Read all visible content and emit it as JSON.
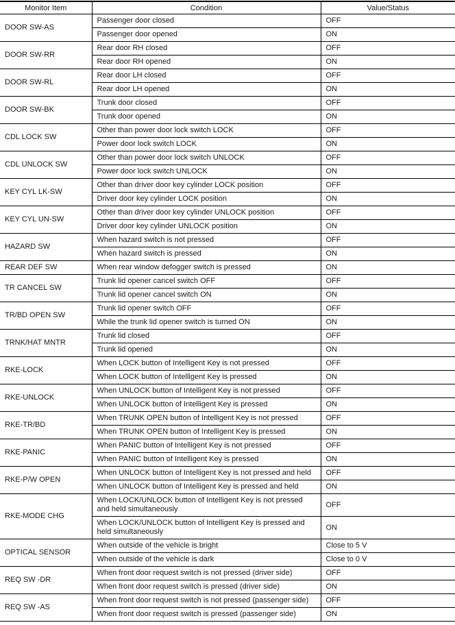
{
  "table": {
    "headers": [
      "Monitor Item",
      "Condition",
      "Value/Status"
    ],
    "items": [
      {
        "name": "DOOR SW-AS",
        "rows": [
          {
            "condition": "Passenger door closed",
            "value": "OFF"
          },
          {
            "condition": "Passenger door opened",
            "value": "ON"
          }
        ]
      },
      {
        "name": "DOOR SW-RR",
        "rows": [
          {
            "condition": "Rear door RH closed",
            "value": "OFF"
          },
          {
            "condition": "Rear door RH opened",
            "value": "ON"
          }
        ]
      },
      {
        "name": "DOOR SW-RL",
        "rows": [
          {
            "condition": "Rear door LH closed",
            "value": "OFF"
          },
          {
            "condition": "Rear door LH opened",
            "value": "ON"
          }
        ]
      },
      {
        "name": "DOOR SW-BK",
        "rows": [
          {
            "condition": "Trunk door closed",
            "value": "OFF"
          },
          {
            "condition": "Trunk door opened",
            "value": "ON"
          }
        ]
      },
      {
        "name": "CDL LOCK SW",
        "rows": [
          {
            "condition": "Other than power door lock switch LOCK",
            "value": "OFF"
          },
          {
            "condition": "Power door lock switch LOCK",
            "value": "ON"
          }
        ]
      },
      {
        "name": "CDL UNLOCK SW",
        "rows": [
          {
            "condition": "Other than power door lock switch UNLOCK",
            "value": "OFF"
          },
          {
            "condition": "Power door lock switch UNLOCK",
            "value": "ON"
          }
        ]
      },
      {
        "name": "KEY CYL LK-SW",
        "rows": [
          {
            "condition": "Other than driver door key cylinder LOCK position",
            "value": "OFF"
          },
          {
            "condition": "Driver door key cylinder LOCK position",
            "value": "ON"
          }
        ]
      },
      {
        "name": "KEY CYL UN-SW",
        "rows": [
          {
            "condition": "Other than driver door key cylinder UNLOCK position",
            "value": "OFF"
          },
          {
            "condition": "Driver door key cylinder UNLOCK position",
            "value": "ON"
          }
        ]
      },
      {
        "name": "HAZARD SW",
        "rows": [
          {
            "condition": "When hazard switch is not pressed",
            "value": "OFF"
          },
          {
            "condition": "When hazard switch is pressed",
            "value": "ON"
          }
        ]
      },
      {
        "name": "REAR DEF SW",
        "rows": [
          {
            "condition": "When rear window defogger switch is pressed",
            "value": "ON"
          }
        ]
      },
      {
        "name": "TR CANCEL SW",
        "rows": [
          {
            "condition": "Trunk lid opener cancel switch OFF",
            "value": "OFF"
          },
          {
            "condition": "Trunk lid opener cancel switch ON",
            "value": "ON"
          }
        ]
      },
      {
        "name": "TR/BD OPEN SW",
        "rows": [
          {
            "condition": "Trunk lid opener switch OFF",
            "value": "OFF"
          },
          {
            "condition": "While the trunk lid opener switch is turned ON",
            "value": "ON"
          }
        ]
      },
      {
        "name": "TRNK/HAT MNTR",
        "rows": [
          {
            "condition": "Trunk lid closed",
            "value": "OFF"
          },
          {
            "condition": "Trunk lid opened",
            "value": "ON"
          }
        ]
      },
      {
        "name": "RKE-LOCK",
        "rows": [
          {
            "condition": "When LOCK button of Intelligent Key is not pressed",
            "value": "OFF"
          },
          {
            "condition": "When LOCK button of Intelligent Key is pressed",
            "value": "ON"
          }
        ]
      },
      {
        "name": "RKE-UNLOCK",
        "rows": [
          {
            "condition": "When UNLOCK button of Intelligent Key is not pressed",
            "value": "OFF"
          },
          {
            "condition": "When UNLOCK button of Intelligent Key is pressed",
            "value": "ON"
          }
        ]
      },
      {
        "name": "RKE-TR/BD",
        "rows": [
          {
            "condition": "When TRUNK OPEN button of Intelligent Key is not pressed",
            "value": "OFF"
          },
          {
            "condition": "When TRUNK OPEN button of Intelligent Key is pressed",
            "value": "ON"
          }
        ]
      },
      {
        "name": "RKE-PANIC",
        "rows": [
          {
            "condition": "When PANIC button of Intelligent Key is not pressed",
            "value": "OFF"
          },
          {
            "condition": "When PANIC button of Intelligent Key is pressed",
            "value": "ON"
          }
        ]
      },
      {
        "name": "RKE-P/W OPEN",
        "rows": [
          {
            "condition": "When UNLOCK button of Intelligent Key is not pressed and held",
            "value": "OFF"
          },
          {
            "condition": "When UNLOCK button of Intelligent Key is pressed and held",
            "value": "ON"
          }
        ]
      },
      {
        "name": "RKE-MODE CHG",
        "tall": true,
        "rows": [
          {
            "condition": "When LOCK/UNLOCK button of Intelligent Key is not pressed and held simultaneously",
            "value": "OFF"
          },
          {
            "condition": "When LOCK/UNLOCK button of Intelligent Key is pressed and held simultaneously",
            "value": "ON"
          }
        ]
      },
      {
        "name": "OPTICAL SENSOR",
        "rows": [
          {
            "condition": "When outside of the vehicle is bright",
            "value": "Close to 5 V"
          },
          {
            "condition": "When outside of the vehicle is dark",
            "value": "Close to 0 V"
          }
        ]
      },
      {
        "name": "REQ SW -DR",
        "rows": [
          {
            "condition": "When front door request switch is not pressed (driver side)",
            "value": "OFF"
          },
          {
            "condition": "When front door request switch is pressed (driver side)",
            "value": "ON"
          }
        ]
      },
      {
        "name": "REQ SW -AS",
        "rows": [
          {
            "condition": "When front door request switch is not pressed (passenger side)",
            "value": "OFF"
          },
          {
            "condition": "When front door request switch is pressed (passenger side)",
            "value": "ON"
          }
        ]
      }
    ]
  }
}
